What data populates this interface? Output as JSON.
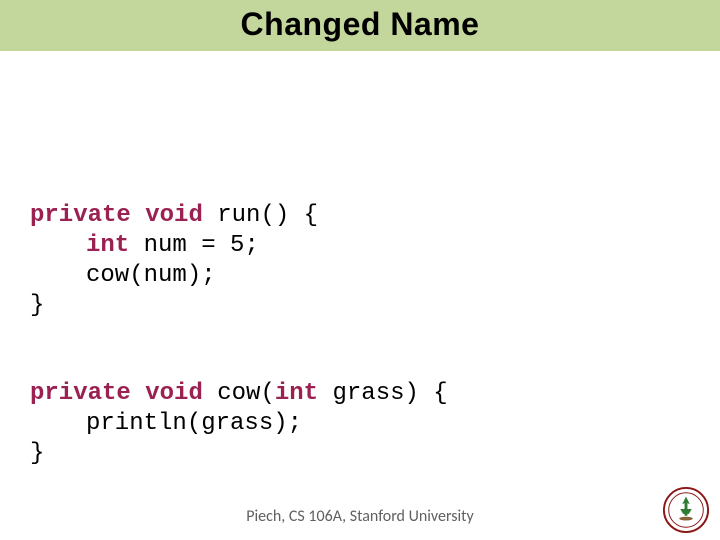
{
  "title": "Changed Name",
  "code": {
    "block1": {
      "l1a": "private",
      "l1b": " ",
      "l1c": "void",
      "l1d": " run() {",
      "l2a": "int",
      "l2b": " num = 5;",
      "l3a": "cow(num);",
      "l4a": "}"
    },
    "block2": {
      "l1a": "private",
      "l1b": " ",
      "l1c": "void",
      "l1d": " cow(",
      "l1e": "int",
      "l1f": " grass) {",
      "l2a": "println(grass);",
      "l3a": "}"
    }
  },
  "footer": "Piech, CS 106A, Stanford University",
  "seal_alt": "Stanford University seal"
}
